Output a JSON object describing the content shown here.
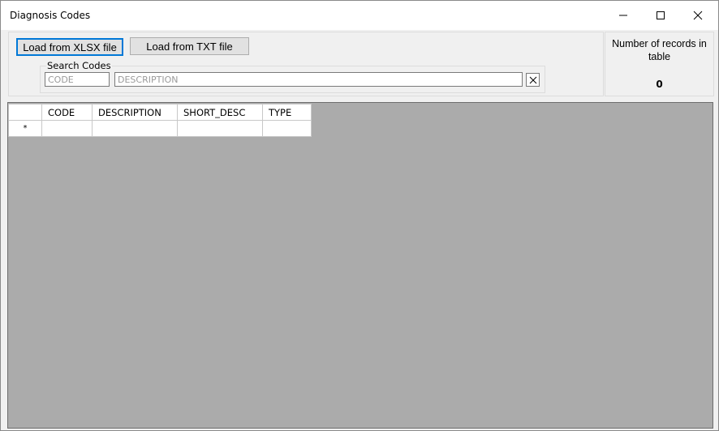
{
  "window": {
    "title": "Diagnosis Codes",
    "controls": {
      "minimize": "—",
      "maximize": "☐",
      "close": "✕"
    }
  },
  "toolbar": {
    "load_xlsx_label": "Load from XLSX file",
    "load_txt_label": "Load from TXT file"
  },
  "search": {
    "group_label": "Search Codes",
    "code_placeholder": "CODE",
    "description_placeholder": "DESCRIPTION",
    "clear_label": "✕"
  },
  "stats": {
    "label": "Number of records in table",
    "count": "0"
  },
  "grid": {
    "columns": [
      "CODE",
      "DESCRIPTION",
      "SHORT_DESC",
      "TYPE"
    ],
    "new_row_marker": "*",
    "rows": []
  }
}
